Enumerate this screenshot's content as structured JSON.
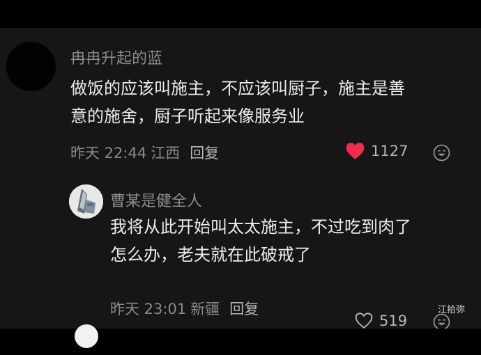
{
  "comments": [
    {
      "username": "冉冉升起的蓝",
      "text_lines": [
        "做饭的应该叫施主，不应该叫厨子，施主是善",
        "意的施舍，厨子听起来像服务业"
      ],
      "time": "昨天 22:44",
      "location": "江西",
      "reply_label": "回复",
      "like_count": "1127",
      "liked": true,
      "like_icon": "heart-filled-icon",
      "emoji_icon": "smiley-icon"
    },
    {
      "username": "曹某是健全人",
      "text_lines": [
        "我将从此开始叫太太施主，不过吃到肉了",
        "怎么办，老夫就在此破戒了"
      ],
      "time": "昨天 23:01",
      "location": "新疆",
      "reply_label": "回复",
      "like_count": "519",
      "liked": false,
      "like_icon": "heart-outline-icon",
      "emoji_icon": "smiley-icon"
    }
  ],
  "watermark": "江拾弥",
  "colors": {
    "background": "#161616",
    "text": "#ececec",
    "muted": "#8a8a8a",
    "like_red": "#ef2d4f"
  }
}
